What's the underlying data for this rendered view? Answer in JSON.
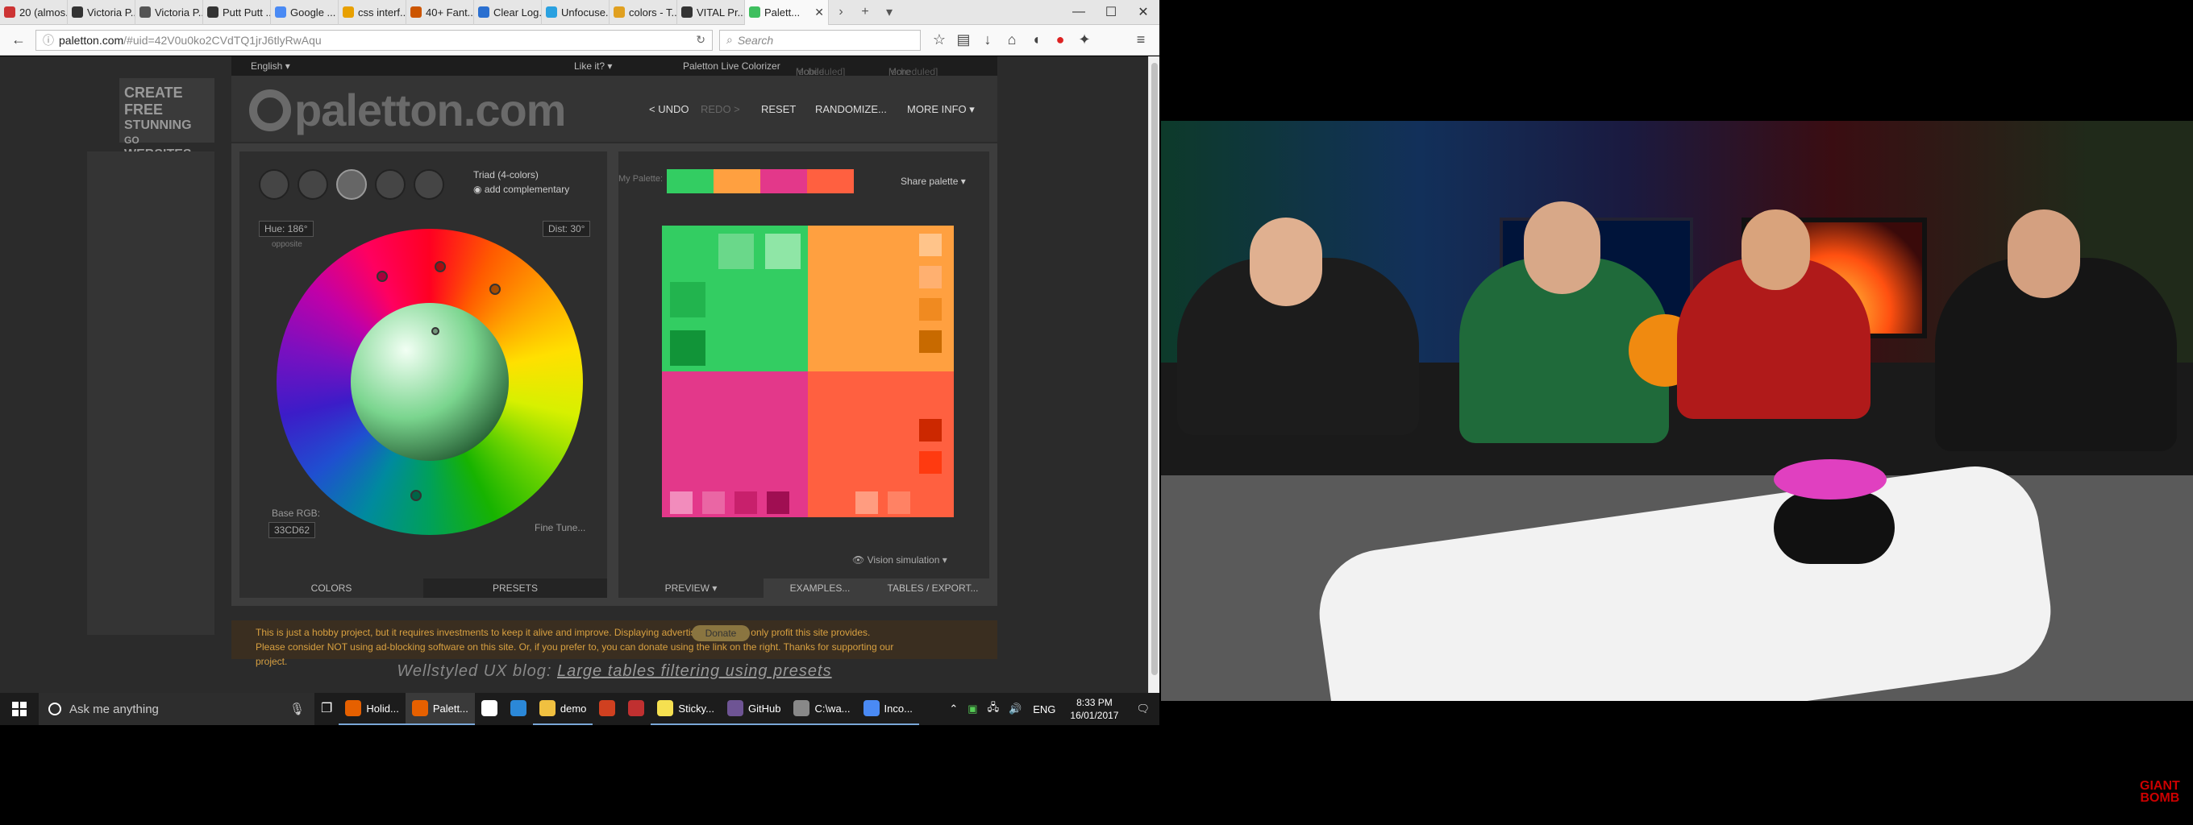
{
  "browser": {
    "tabs": [
      {
        "label": "20 (almos...",
        "color": "#cc3333"
      },
      {
        "label": "Victoria P...",
        "color": "#333333"
      },
      {
        "label": "Victoria P...",
        "color": "#555555"
      },
      {
        "label": "Putt Putt ...",
        "color": "#333333"
      },
      {
        "label": "Google ...",
        "color": "#4a8af4"
      },
      {
        "label": "css interf...",
        "color": "#e8a000"
      },
      {
        "label": "40+ Fant...",
        "color": "#cc5500"
      },
      {
        "label": "Clear Log...",
        "color": "#2a6fd0"
      },
      {
        "label": "Unfocuse...",
        "color": "#2aa1e0"
      },
      {
        "label": "colors - T...",
        "color": "#e0a020"
      },
      {
        "label": "VITAL Pr...",
        "color": "#333333"
      }
    ],
    "active_tab": {
      "label": "Palett...",
      "color": "#3fbf5f"
    },
    "new_tab": "+",
    "url_host": "paletton.com",
    "url_path": "/#uid=42V0u0ko2CVdTQ1jrJ6tlyRwAqu",
    "search_placeholder": "Search",
    "window_controls": [
      "—",
      "☐",
      "✕"
    ]
  },
  "paletton": {
    "language": "English ▾",
    "like_it": "Like it? ▾",
    "live_colorizer": "Paletton Live Colorizer",
    "mobile": "Mobile",
    "mobile_sched": "[scheduled]",
    "more_apps": "More apps",
    "more_apps_sched": "[scheduled]",
    "ad_line1": "CREATE FREE",
    "ad_line2": "STUNNING",
    "ad_line3": "WEBSITES",
    "ad_go": "GO",
    "logo": "paletton.com",
    "menu": {
      "undo": "< UNDO",
      "redo": "REDO >",
      "reset": "RESET",
      "randomize": "RANDOMIZE...",
      "more_info": "MORE INFO ▾"
    },
    "scheme_label": "Triad (4-colors)",
    "add_complementary": "add complementary",
    "hue": "Hue: 186°",
    "hue_sub": "opposite",
    "dist": "Dist: 30°",
    "base_rgb_label": "Base RGB:",
    "base_rgb": "33CD62",
    "fine_tune": "Fine Tune...",
    "tab_colors": "COLORS",
    "tab_presets": "PRESETS",
    "my_palette": "My Palette:",
    "share_palette": "Share palette ▾",
    "vision_sim": "Vision simulation ▾",
    "tab_preview": "PREVIEW ▾",
    "tab_examples": "EXAMPLES...",
    "tab_tables": "TABLES / EXPORT...",
    "notice": "This is just a hobby project, but it requires investments to keep it alive and improve. Displaying advertisement is the only profit this site provides. Please consider NOT using ad-blocking software on this site. Or, if you prefer to, you can donate using the link on the right. Thanks for supporting our project.",
    "donate": "Donate",
    "blog_prefix": "Wellstyled UX blog:",
    "blog_link": "Large tables filtering using presets",
    "colors": {
      "green": "#33cd62",
      "orange": "#ffa040",
      "pink": "#e3388a",
      "red": "#ff6040"
    }
  },
  "taskbar": {
    "cortana": "Ask me anything",
    "apps": [
      {
        "label": "Holid...",
        "color": "#e66000",
        "open": true,
        "active": false
      },
      {
        "label": "Palett...",
        "color": "#e66000",
        "open": true,
        "active": true
      },
      {
        "label": "",
        "color": "#ffffff",
        "open": false,
        "active": false
      },
      {
        "label": "",
        "color": "#2b88d8",
        "open": false,
        "active": false
      },
      {
        "label": "demo",
        "color": "#f0c040",
        "open": true,
        "active": false
      },
      {
        "label": "",
        "color": "#d04020",
        "open": false,
        "active": false
      },
      {
        "label": "",
        "color": "#c03030",
        "open": false,
        "active": false
      },
      {
        "label": "Sticky...",
        "color": "#f5e050",
        "open": true,
        "active": false
      },
      {
        "label": "GitHub",
        "color": "#6e5494",
        "open": true,
        "active": false
      },
      {
        "label": "C:\\wa...",
        "color": "#888888",
        "open": true,
        "active": false
      },
      {
        "label": "Inco...",
        "color": "#4a8af4",
        "open": true,
        "active": false
      }
    ],
    "lang": "ENG",
    "time": "8:33 PM",
    "date": "16/01/2017"
  },
  "video": {
    "watermark_line1": "GIANT",
    "watermark_line2": "BOMB"
  }
}
